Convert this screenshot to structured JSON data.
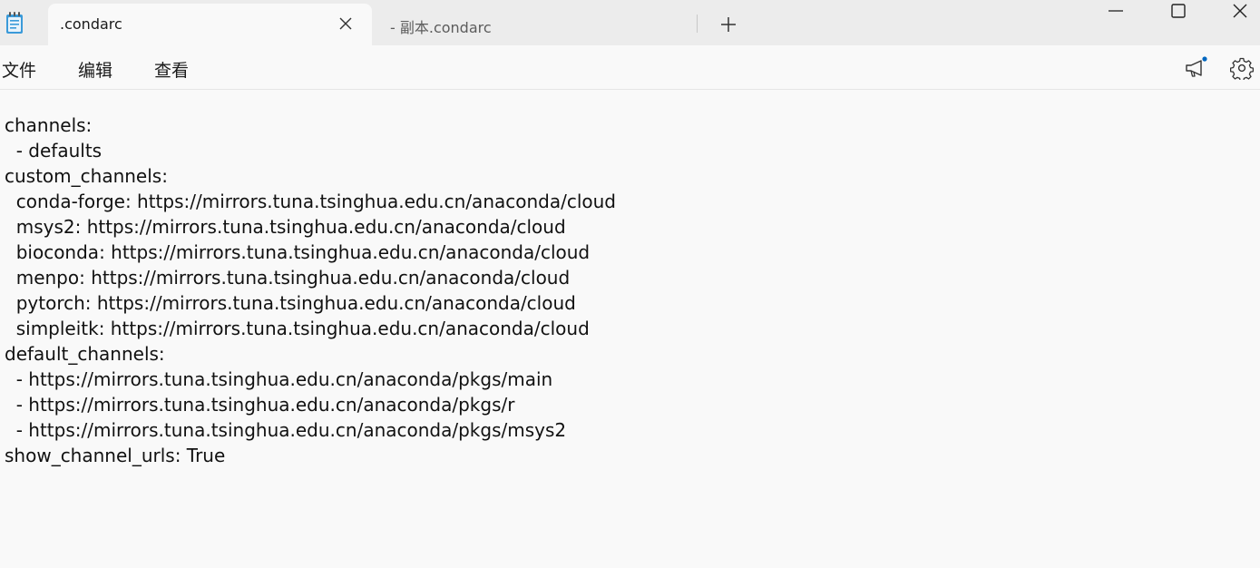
{
  "window": {
    "app_icon": "notepad-icon",
    "controls": {
      "minimize": "minimize-icon",
      "maximize": "maximize-icon",
      "close": "close-icon"
    }
  },
  "tabs": [
    {
      "label": ".condarc",
      "active": true
    },
    {
      "label": "- 副本.condarc",
      "active": false
    }
  ],
  "new_tab_icon": "plus-icon",
  "menu": {
    "items": [
      "文件",
      "编辑",
      "查看"
    ],
    "right_icons": [
      "megaphone-icon",
      "gear-icon"
    ],
    "notification_dot_color": "#0067c0"
  },
  "editor": {
    "lines": [
      "channels:",
      "  - defaults",
      "custom_channels:",
      "  conda-forge: https://mirrors.tuna.tsinghua.edu.cn/anaconda/cloud",
      "  msys2: https://mirrors.tuna.tsinghua.edu.cn/anaconda/cloud",
      "  bioconda: https://mirrors.tuna.tsinghua.edu.cn/anaconda/cloud",
      "  menpo: https://mirrors.tuna.tsinghua.edu.cn/anaconda/cloud",
      "  pytorch: https://mirrors.tuna.tsinghua.edu.cn/anaconda/cloud",
      "  simpleitk: https://mirrors.tuna.tsinghua.edu.cn/anaconda/cloud",
      "default_channels:",
      "  - https://mirrors.tuna.tsinghua.edu.cn/anaconda/pkgs/main",
      "  - https://mirrors.tuna.tsinghua.edu.cn/anaconda/pkgs/r",
      "  - https://mirrors.tuna.tsinghua.edu.cn/anaconda/pkgs/msys2",
      "show_channel_urls: True"
    ]
  }
}
